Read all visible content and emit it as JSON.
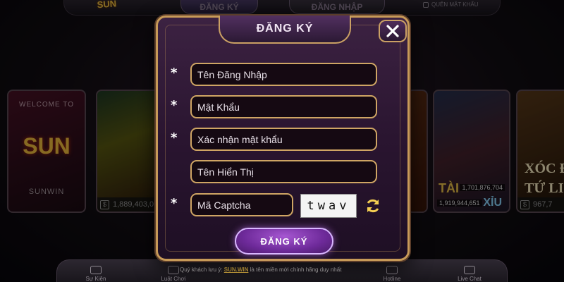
{
  "top_bar": {
    "logo_text": "SUN",
    "tab_register": "ĐĂNG KÝ",
    "tab_login": "ĐĂNG NHẬP",
    "forgot_password": "QUÊN MẬT KHẨU"
  },
  "cards": [
    {
      "welcome": "WELCOME TO",
      "title": "SUN",
      "label": "SUNWIN"
    },
    {
      "amount": "1,889,403,0"
    },
    {
      "amount": ""
    },
    {
      "tai": "TÀI",
      "xiu": "XỈU",
      "left_amount": "1,919,944,651",
      "right_amount": "1,701,876,704"
    },
    {
      "title": "XÓC Đ\nTỨ LI",
      "amount": "967,7"
    }
  ],
  "modal": {
    "title": "ĐĂNG KÝ",
    "fields": {
      "username_placeholder": "Tên Đăng Nhập",
      "password_placeholder": "Mật Khẩu",
      "confirm_password_placeholder": "Xác nhận mật khẩu",
      "display_name_placeholder": "Tên Hiển Thị",
      "captcha_placeholder": "Mã Captcha"
    },
    "required_mark": "*",
    "captcha_text": "twav",
    "submit_label": "ĐĂNG KÝ"
  },
  "notice": {
    "prefix": "Quý khách lưu ý:",
    "highlight": "SUN.WIN",
    "suffix": "là tên miền mới chính hãng duy nhất"
  },
  "bottom_bar": {
    "items": [
      "Sự Kiện",
      "Luật Chơi",
      "Hotline",
      "Live Chat"
    ]
  },
  "colors": {
    "modal_border": "#c79a58",
    "field_border": "#cfa564",
    "submit_button": "#8a3bb8",
    "highlight": "#f3c34b"
  }
}
